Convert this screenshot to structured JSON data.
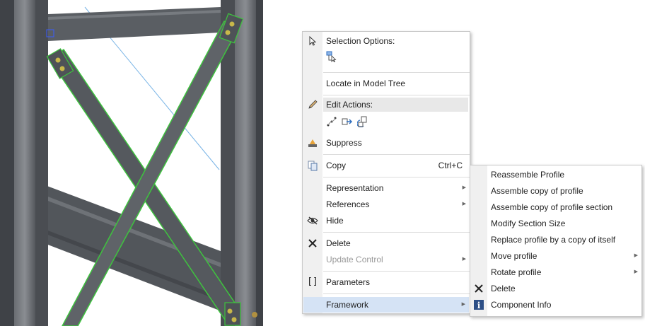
{
  "main_menu": {
    "selection_options_label": "Selection Options:",
    "locate_label": "Locate in Model Tree",
    "edit_actions_label": "Edit Actions:",
    "suppress_label": "Suppress",
    "copy_label": "Copy",
    "copy_shortcut": "Ctrl+C",
    "representation_label": "Representation",
    "references_label": "References",
    "hide_label": "Hide",
    "delete_label": "Delete",
    "update_control_label": "Update Control",
    "parameters_label": "Parameters",
    "framework_label": "Framework"
  },
  "sub_menu": {
    "items": [
      "Reassemble Profile",
      "Assemble copy of profile",
      "Assemble copy of profile section",
      "Modify Section Size",
      "Replace profile by a copy of itself",
      "Move profile",
      "Rotate profile",
      "Delete",
      "Component Info"
    ]
  },
  "colors": {
    "beam": "#5b5e63",
    "beam_outline": "#3ec43e",
    "menu_highlight": "#d5e3f5",
    "gutter": "#f0f0f0"
  }
}
